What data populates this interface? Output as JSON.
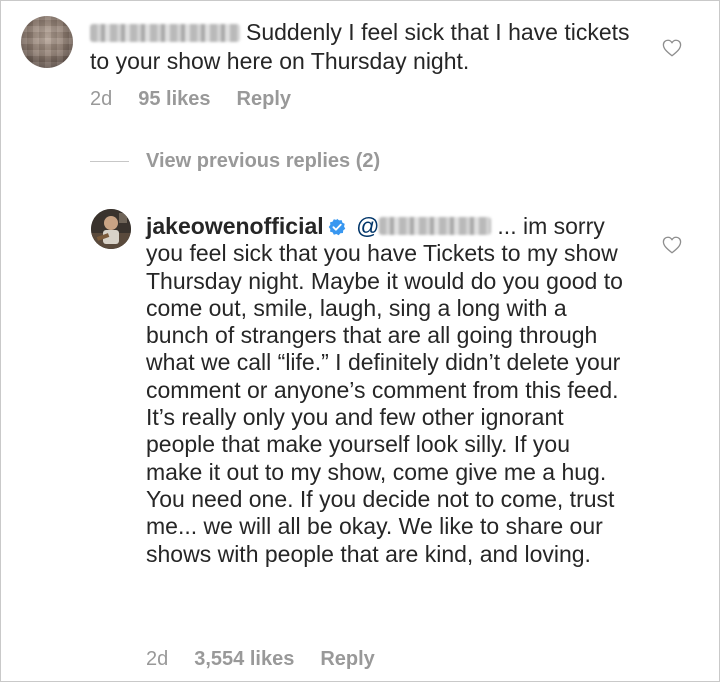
{
  "top_comment": {
    "text": "Suddenly I feel sick that I have tickets to your show here on Thursday night.",
    "age": "2d",
    "likes": "95 likes",
    "reply_label": "Reply"
  },
  "view_previous": {
    "label": "View previous replies (2)"
  },
  "reply_comment": {
    "username": "jakeowenofficial",
    "mention_prefix": "@",
    "text": "... im sorry you feel sick that you have Tickets to my show Thursday night. Maybe it would do you good to come out, smile, laugh, sing a long with a bunch of strangers that are all going through what we call “life.” I definitely didn’t delete your comment or anyone’s comment from this feed. It’s really only you and few other ignorant people that make yourself look silly. If you make it out to my show, come give me a hug. You need one. If you decide not to come, trust me... we will all be okay. We like to share our shows with people that are kind, and loving.",
    "age": "2d",
    "likes": "3,554 likes",
    "reply_label": "Reply"
  },
  "icons": {
    "like": "heart-outline-icon",
    "verified": "verified-badge-icon"
  },
  "colors": {
    "text": "#262626",
    "meta": "#999999",
    "verified_blue": "#3897f0",
    "mention": "#003569"
  }
}
